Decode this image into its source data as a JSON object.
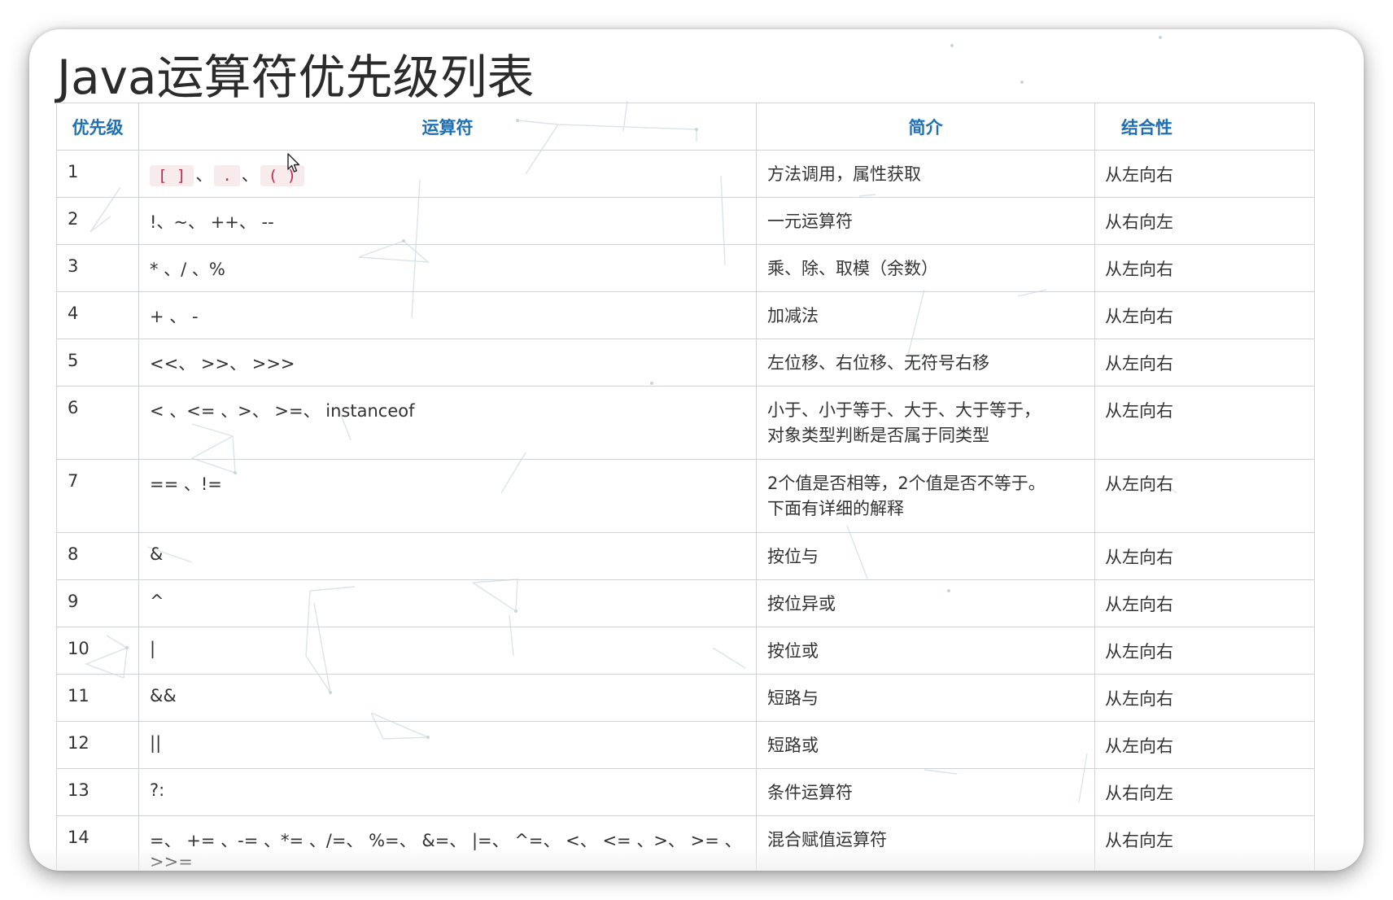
{
  "title": "Java运算符优先级列表",
  "table": {
    "headers": {
      "level": "优先级",
      "operator": "运算符",
      "desc": "简介",
      "assoc": "结合性"
    },
    "rows": [
      {
        "level": "1",
        "operator": "",
        "code_ops": [
          "[ ]",
          ".",
          "( )"
        ],
        "code_sep": "、",
        "desc": [
          "方法调用，属性获取"
        ],
        "assoc": "从左向右"
      },
      {
        "level": "2",
        "operator": "!、~、 ++、 --",
        "desc": [
          "一元运算符"
        ],
        "assoc": "从右向左"
      },
      {
        "level": "3",
        "operator": "* 、/ 、%",
        "desc": [
          "乘、除、取模（余数）"
        ],
        "assoc": "从左向右"
      },
      {
        "level": "4",
        "operator": "+ 、 -",
        "desc": [
          "加减法"
        ],
        "assoc": "从左向右"
      },
      {
        "level": "5",
        "operator": "<<、 >>、 >>>",
        "desc": [
          "左位移、右位移、无符号右移"
        ],
        "assoc": "从左向右"
      },
      {
        "level": "6",
        "operator": "< 、<= 、>、 >=、 instanceof",
        "desc": [
          "小于、小于等于、大于、大于等于，",
          "对象类型判断是否属于同类型"
        ],
        "assoc": "从左向右"
      },
      {
        "level": "7",
        "operator": "== 、!=",
        "desc": [
          "2个值是否相等，2个值是否不等于。",
          "下面有详细的解释"
        ],
        "assoc": "从左向右"
      },
      {
        "level": "8",
        "operator": "&",
        "desc": [
          "按位与"
        ],
        "assoc": "从左向右"
      },
      {
        "level": "9",
        "operator": "^",
        "desc": [
          "按位异或"
        ],
        "assoc": "从左向右"
      },
      {
        "level": "10",
        "operator": "|",
        "desc": [
          "按位或"
        ],
        "assoc": "从左向右"
      },
      {
        "level": "11",
        "operator": "&&",
        "desc": [
          "短路与"
        ],
        "assoc": "从左向右"
      },
      {
        "level": "12",
        "operator": "||",
        "desc": [
          "短路或"
        ],
        "assoc": "从左向右"
      },
      {
        "level": "13",
        "operator": "?:",
        "desc": [
          "条件运算符"
        ],
        "assoc": "从右向左"
      },
      {
        "level": "14",
        "operator": "=、 += 、-= 、*= 、/=、 %=、 &=、 |=、 ^=、 <、 <= 、>、 >= 、>>=",
        "desc": [
          "混合赋值运算符"
        ],
        "assoc": "从右向左"
      }
    ]
  },
  "colors": {
    "header_text": "#1f6fb3",
    "border": "#cfd3d6",
    "code_bg": "#f7eceb",
    "code_text": "#c7254e",
    "title_text": "#2b2b2b"
  },
  "icons": {
    "cursor": "mouse-pointer-icon",
    "background": "network-lines-decoration"
  }
}
